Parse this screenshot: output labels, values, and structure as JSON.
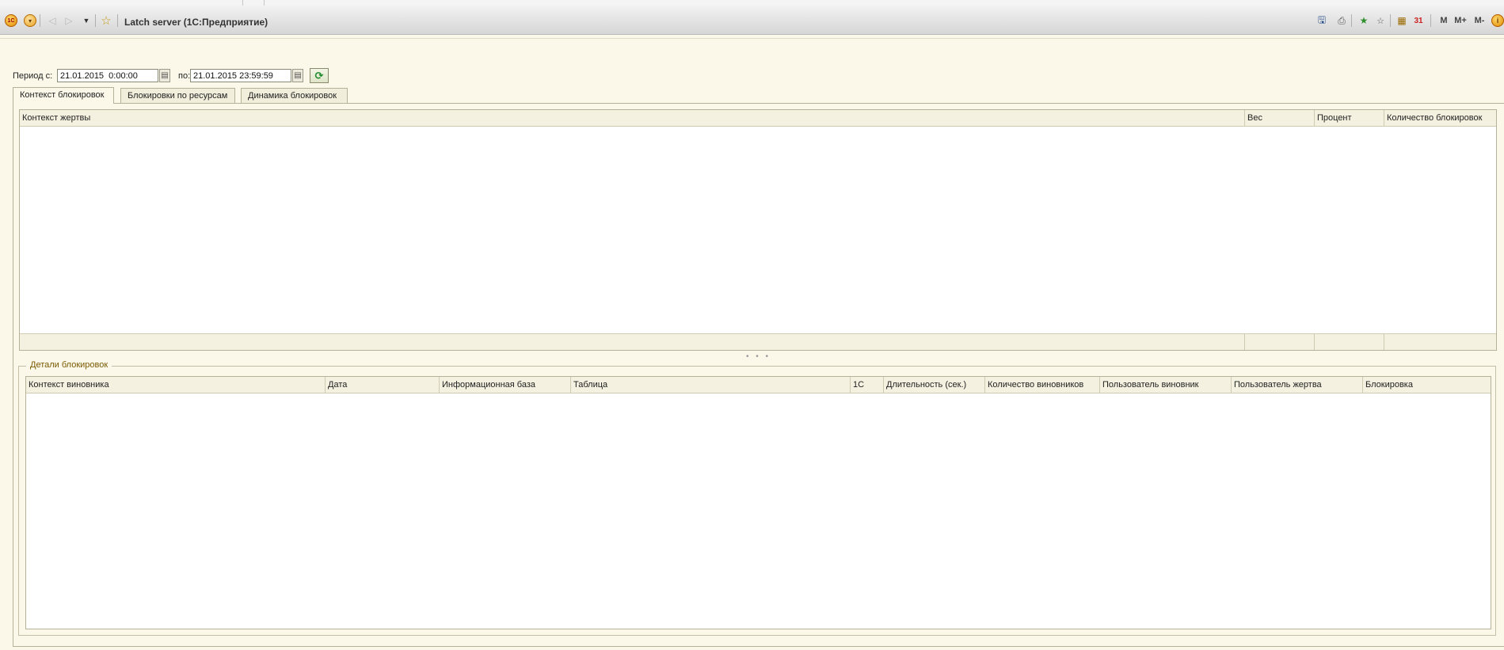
{
  "window": {
    "title": "Latch server (1С:Предприятие)"
  },
  "toolbar_left": {
    "logo_text": "1С",
    "menu_glyph": "▾",
    "back_glyph": "◁",
    "forward_glyph": "▷",
    "history_glyph": "▼",
    "favorites_glyph": "☆"
  },
  "toolbar_right": {
    "save_glyph": "🖫",
    "print_glyph": "⎙",
    "add_favorite_glyph": "★",
    "favorite_glyph": "☆",
    "calculator_glyph": "▦",
    "calendar_glyph": "31",
    "m_label": "M",
    "m_plus_label": "M+",
    "m_minus_label": "M-",
    "info_glyph": "i"
  },
  "period": {
    "from_label": "Период с:",
    "from_value": "21.01.2015  0:00:00",
    "to_label": "по:",
    "to_value": "21.01.2015 23:59:59",
    "calendar_glyph": "▤",
    "refresh_glyph": "⟳"
  },
  "tabs": [
    {
      "label": "Контекст блокировок"
    },
    {
      "label": "Блокировки по ресурсам"
    },
    {
      "label": "Динамика блокировок"
    }
  ],
  "victims_table": {
    "columns": [
      "Контекст жертвы",
      "Вес",
      "Процент",
      "Количество блокировок"
    ]
  },
  "splitter_glyph": "• • •",
  "details_group": {
    "title": "Детали блокировок",
    "columns": [
      "Контекст виновника",
      "Дата",
      "Информационная база",
      "Таблица",
      "1С",
      "Длительность (сек.)",
      "Количество виновников",
      "Пользователь виновник",
      "Пользователь жертва",
      "Блокировка"
    ]
  }
}
